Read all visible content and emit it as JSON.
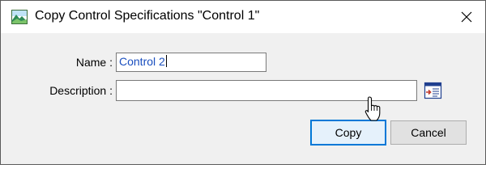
{
  "window": {
    "title": "Copy Control Specifications \"Control 1\"",
    "icon": "mountain-landscape-icon",
    "close_icon": "close-icon"
  },
  "form": {
    "name_label": "Name :",
    "name_value": "Control 2",
    "description_label": "Description :",
    "description_value": "",
    "editor_icon": "text-editor-icon"
  },
  "buttons": {
    "copy_label": "Copy",
    "cancel_label": "Cancel"
  },
  "colors": {
    "accent": "#0078d7",
    "input_text": "#1a4fbf"
  }
}
